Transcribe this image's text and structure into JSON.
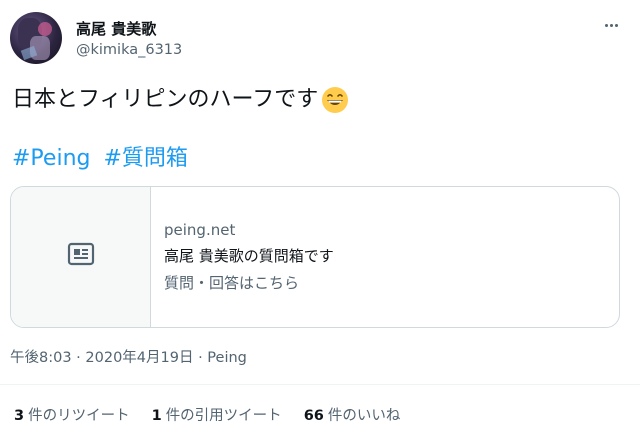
{
  "user": {
    "display_name": "高尾 貴美歌",
    "handle": "@kimika_6313"
  },
  "tweet": {
    "text": "日本とフィリピンのハーフです",
    "emoji": "grinning-face-with-smiling-eyes",
    "hashtags": [
      "#Peing",
      "#質問箱"
    ]
  },
  "card": {
    "domain": "peing.net",
    "title": "高尾 貴美歌の質問箱です",
    "description": "質問・回答はこちら",
    "thumbnail_icon": "article-icon"
  },
  "meta": {
    "timestamp": "午後8:03 · 2020年4月19日 · Peing"
  },
  "stats": {
    "retweets": {
      "count": "3",
      "label": "件のリツイート"
    },
    "quotes": {
      "count": "1",
      "label": "件の引用ツイート"
    },
    "likes": {
      "count": "66",
      "label": "件のいいね"
    }
  },
  "colors": {
    "link": "#1d9bf0",
    "secondary_text": "#536471",
    "border": "#cfd9de"
  }
}
